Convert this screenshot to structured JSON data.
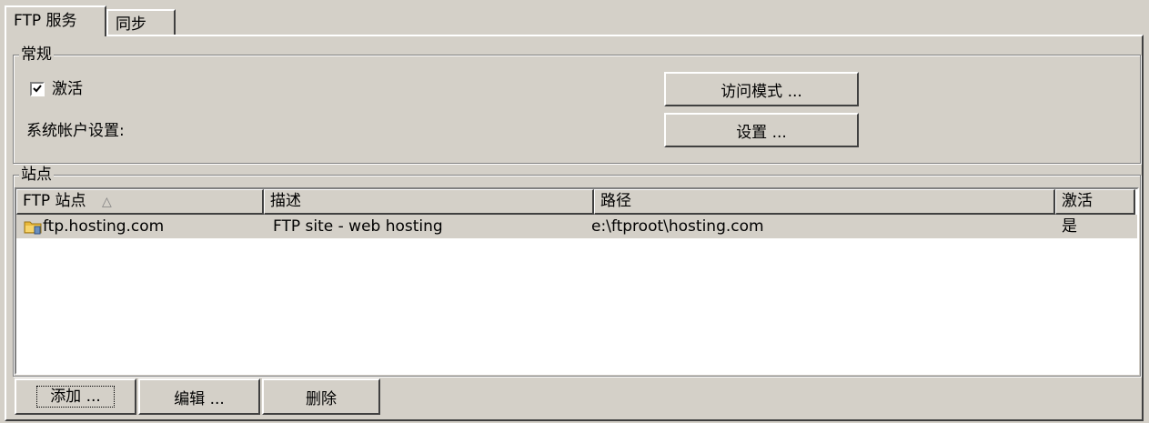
{
  "tabs": [
    {
      "label": "FTP 服务",
      "active": true
    },
    {
      "label": "同步",
      "active": false
    }
  ],
  "general": {
    "legend": "常规",
    "activate_label": "激活",
    "activate_checked": true,
    "system_account_label": "系统帐户设置:",
    "access_mode_button": "访问模式 ...",
    "settings_button": "设置 ..."
  },
  "sites": {
    "legend": "站点",
    "columns": [
      "FTP 站点",
      "描述",
      "路径",
      "激活"
    ],
    "sort_indicator": "△",
    "rows": [
      {
        "icon": "folder-icon",
        "site": "ftp.hosting.com",
        "description": "FTP site - web hosting",
        "path": "e:\\ftproot\\hosting.com",
        "active": "是"
      }
    ]
  },
  "buttons": {
    "add": "添加 ...",
    "edit": "编辑 ...",
    "delete": "删除"
  }
}
